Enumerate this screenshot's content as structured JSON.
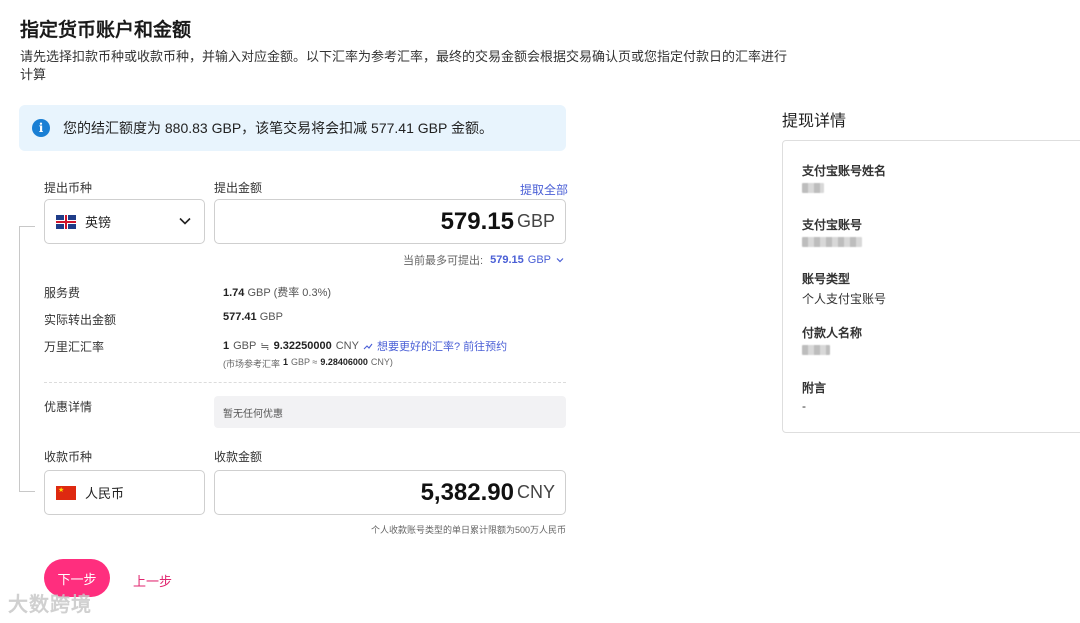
{
  "header": {
    "title": "指定货币账户和金额",
    "description": "请先选择扣款币种或收款币种，并输入对应金额。以下汇率为参考汇率，最终的交易金额会根据交易确认页或您指定付款日的汇率进行计算"
  },
  "notice": {
    "icon": "info-icon",
    "text": "您的结汇额度为 880.83 GBP，该笔交易将会扣减 577.41 GBP 金额。"
  },
  "withdraw": {
    "currency_label": "提出币种",
    "currency_value": "英镑",
    "amount_label": "提出金额",
    "withdraw_all": "提取全部",
    "amount": "579.15",
    "amount_currency": "GBP",
    "max_hint_label": "当前最多可提出:",
    "max_hint_value": "579.15",
    "max_hint_currency": "GBP"
  },
  "fees": {
    "service_fee_label": "服务费",
    "service_fee_value": "1.74",
    "service_fee_cur": "GBP",
    "service_fee_rate": "(费率 0.3%)",
    "actual_label": "实际转出金额",
    "actual_value": "577.41",
    "actual_cur": "GBP",
    "rate_label": "万里汇汇率",
    "rate_base": "1",
    "rate_base_cur": "GBP",
    "rate_symbol": "≒",
    "rate_value": "9.32250000",
    "rate_value_cur": "CNY",
    "rate_link": "想要更好的汇率? 前往预约",
    "market_prefix": "(市场参考汇率",
    "market_base": "1",
    "market_mid": "GBP ≈",
    "market_value": "9.28406000",
    "market_suffix": "CNY)"
  },
  "promo": {
    "label": "优惠详情",
    "value": "暂无任何优惠"
  },
  "receive": {
    "currency_label": "收款币种",
    "currency_value": "人民币",
    "amount_label": "收款金额",
    "amount": "5,382.90",
    "amount_currency": "CNY",
    "limit_hint": "个人收款账号类型的单日累计限额为500万人民币"
  },
  "actions": {
    "next": "下一步",
    "prev": "上一步"
  },
  "watermark": "大数跨境",
  "details": {
    "title": "提现详情",
    "name_label": "支付宝账号姓名",
    "account_label": "支付宝账号",
    "type_label": "账号类型",
    "type_value": "个人支付宝账号",
    "payer_label": "付款人名称",
    "note_label": "附言",
    "note_value": "-"
  },
  "colors": {
    "accent": "#ff2e7e",
    "link": "#4a5fd6",
    "notice_bg": "#e8f4fd",
    "info": "#1a7fd4"
  }
}
